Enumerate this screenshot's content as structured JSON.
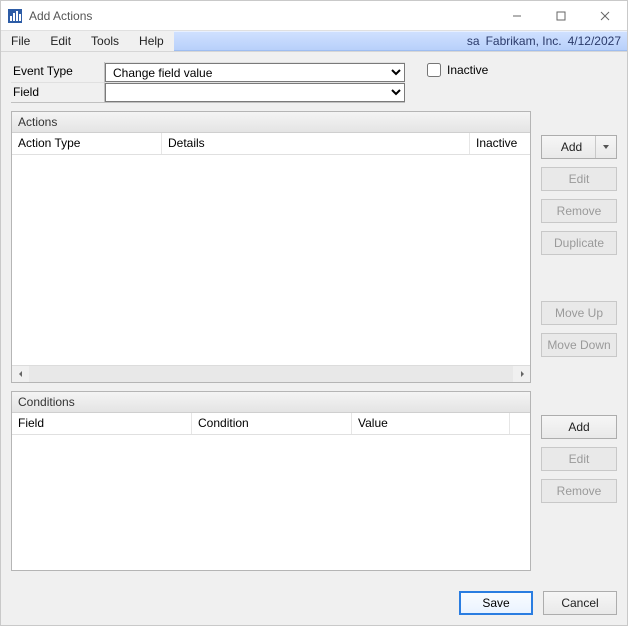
{
  "window": {
    "title": "Add Actions"
  },
  "menu": {
    "file": "File",
    "edit": "Edit",
    "tools": "Tools",
    "help": "Help"
  },
  "context": {
    "user": "sa",
    "company": "Fabrikam, Inc.",
    "date": "4/12/2027"
  },
  "form": {
    "event_type_label": "Event Type",
    "event_type_value": "Change field value",
    "field_label": "Field",
    "field_value": "",
    "inactive_label": "Inactive",
    "inactive_checked": false
  },
  "actions_panel": {
    "title": "Actions",
    "columns": {
      "action_type": "Action Type",
      "details": "Details",
      "inactive": "Inactive"
    }
  },
  "conditions_panel": {
    "title": "Conditions",
    "columns": {
      "field": "Field",
      "condition": "Condition",
      "value": "Value"
    }
  },
  "action_buttons": {
    "add": "Add",
    "edit": "Edit",
    "remove": "Remove",
    "duplicate": "Duplicate",
    "move_up": "Move Up",
    "move_down": "Move Down"
  },
  "condition_buttons": {
    "add": "Add",
    "edit": "Edit",
    "remove": "Remove"
  },
  "footer": {
    "save": "Save",
    "cancel": "Cancel"
  }
}
